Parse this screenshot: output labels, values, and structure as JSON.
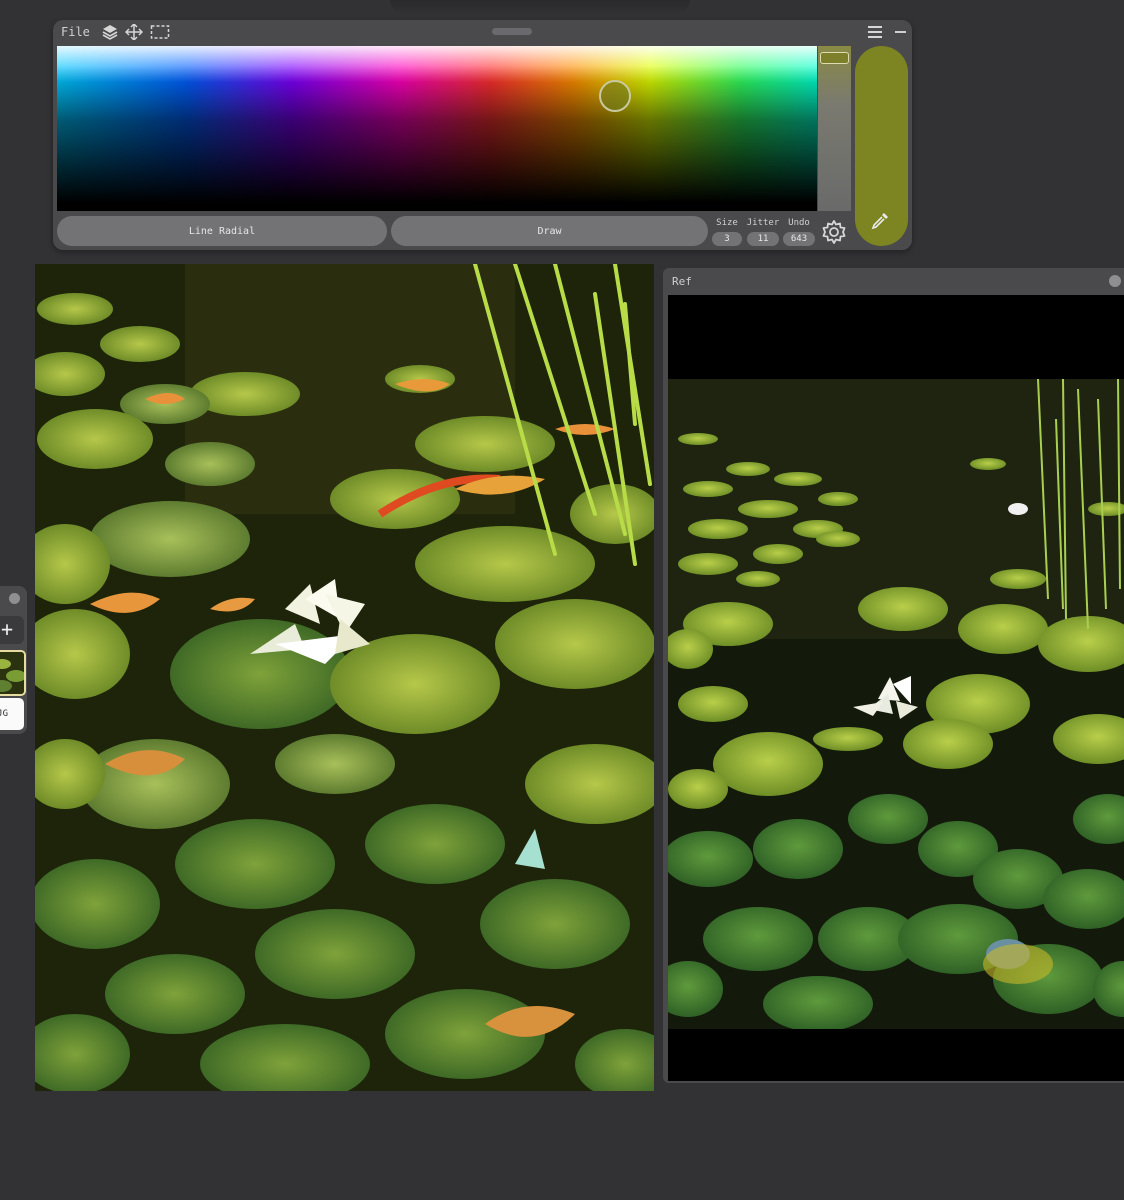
{
  "toolbar": {
    "file_label": "File",
    "icons": [
      "layers-icon",
      "move-icon",
      "selection-icon"
    ],
    "menu_icon": "hamburger-icon",
    "minimize_icon": "minimize-icon"
  },
  "color_picker": {
    "current_color": "#7d8523",
    "value_slider_level": 0.04
  },
  "brush": {
    "brush_label": "Line Radial",
    "mode_label": "Draw",
    "size_label": "Size",
    "size_value": "3",
    "jitter_label": "Jitter",
    "jitter_value": "11",
    "undo_label": "Undo",
    "undo_value": "643"
  },
  "layers": {
    "add_label": "+",
    "layer_tag": "JG"
  },
  "reference": {
    "title": "Ref"
  }
}
